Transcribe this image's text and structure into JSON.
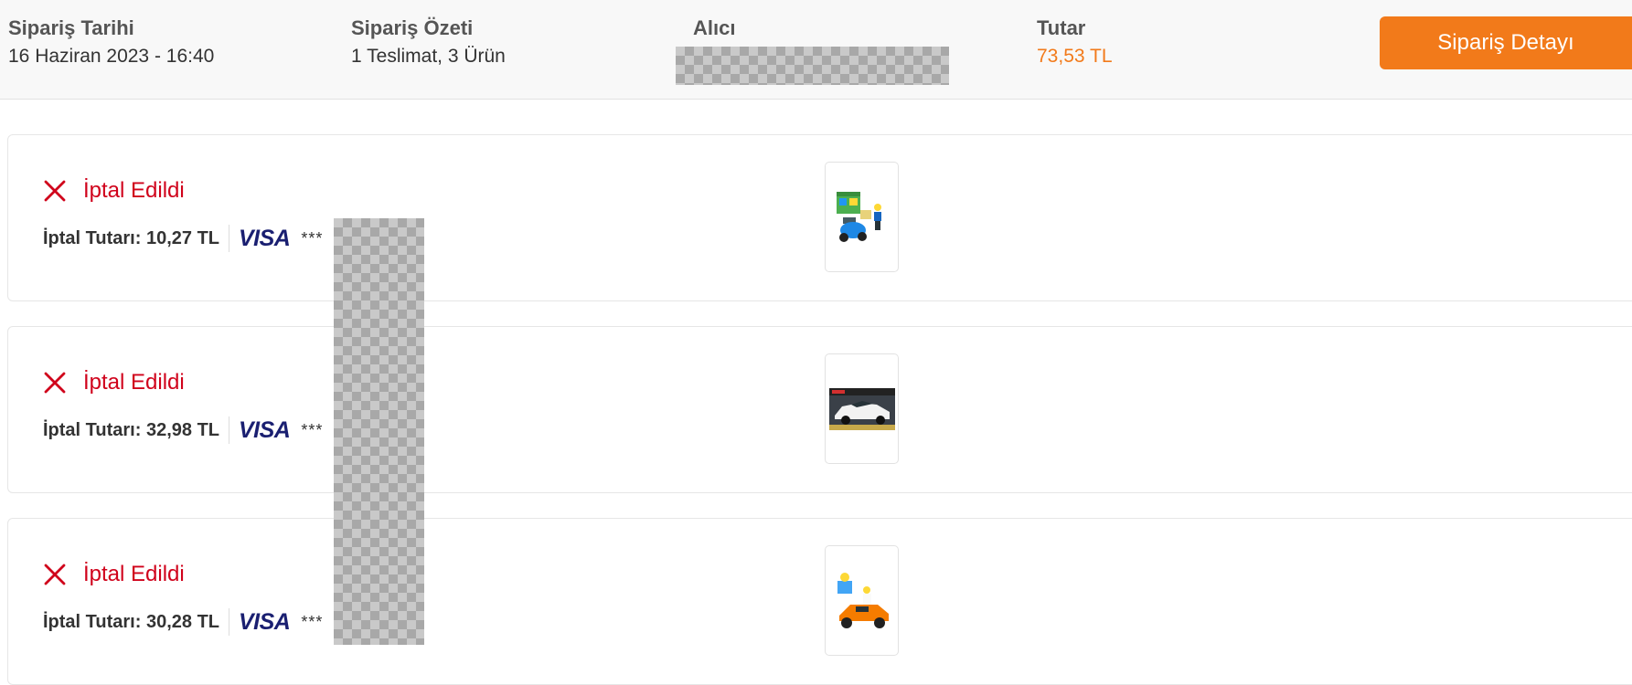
{
  "header": {
    "date_label": "Sipariş Tarihi",
    "date_value": "16 Haziran 2023 - 16:40",
    "summary_label": "Sipariş Özeti",
    "summary_value": "1 Teslimat, 3 Ürün",
    "recipient_label": "Alıcı",
    "total_label": "Tutar",
    "total_value": "73,53 TL",
    "detail_button": "Sipariş Detayı"
  },
  "colors": {
    "accent": "#f27a1a",
    "cancel": "#d0021b",
    "visa": "#1a1f71"
  },
  "items": [
    {
      "status": "İptal Edildi",
      "refund": "İptal Tutarı: 10,27 TL",
      "card_brand": "VISA",
      "card_mask": "***",
      "status_icon": "close-x-icon",
      "thumb": "lego-police-set"
    },
    {
      "status": "İptal Edildi",
      "refund": "İptal Tutarı: 32,98 TL",
      "card_brand": "VISA",
      "card_mask": "***",
      "status_icon": "close-x-icon",
      "thumb": "lego-speed-champions-car"
    },
    {
      "status": "İptal Edildi",
      "refund": "İptal Tutarı: 30,28 TL",
      "card_brand": "VISA",
      "card_mask": "***",
      "status_icon": "close-x-icon",
      "thumb": "lego-race-car-set"
    }
  ]
}
